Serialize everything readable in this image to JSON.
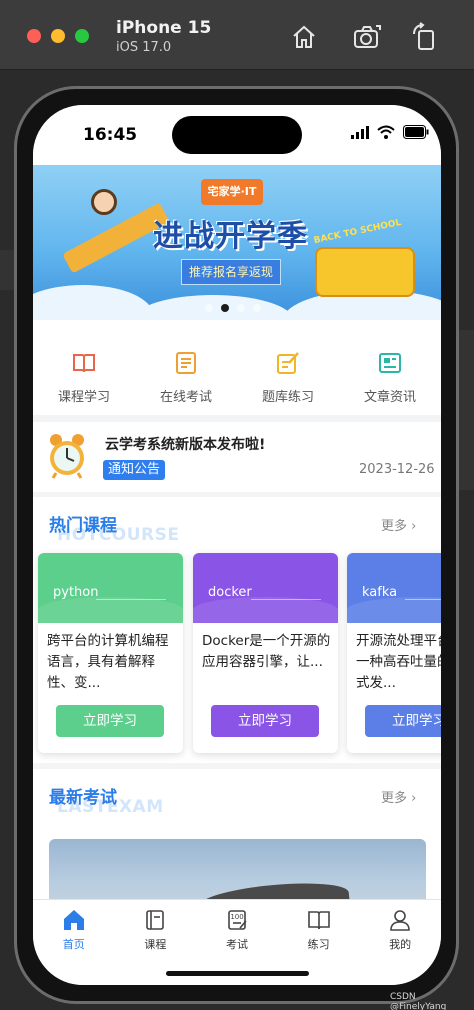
{
  "simulator": {
    "device_name": "iPhone 15",
    "os_version": "iOS 17.0",
    "buttons": [
      "home-icon",
      "screenshot-icon",
      "rotate-icon"
    ]
  },
  "status_bar": {
    "time": "16:45"
  },
  "banner": {
    "logo_text": "宅家学·IT",
    "headline": "进战开学季",
    "promo_button": "推荐报名享返现",
    "tagline": "BACK TO SCHOOL",
    "page_count": 4,
    "active_index": 1
  },
  "categories": [
    {
      "label": "课程学习",
      "icon": "book-icon",
      "color": "#e8674a"
    },
    {
      "label": "在线考试",
      "icon": "exam-form-icon",
      "color": "#f0a030"
    },
    {
      "label": "题库练习",
      "icon": "edit-note-icon",
      "color": "#f0b628"
    },
    {
      "label": "文章资讯",
      "icon": "article-icon",
      "color": "#2bb6a8"
    }
  ],
  "notice": {
    "title": "云学考系统新版本发布啦!",
    "tag": "通知公告",
    "date": "2023-12-26"
  },
  "hot_courses": {
    "title": "热门课程",
    "title_en": "HOTCOURSE",
    "more": "更多",
    "items": [
      {
        "name": "python",
        "description": "跨平台的计算机编程语言，具有着解释性、变...",
        "button": "立即学习",
        "color": "#5ccf8c"
      },
      {
        "name": "docker",
        "description": "Docker是一个开源的应用容器引擎，让...",
        "button": "立即学习",
        "color": "#8a55e6"
      },
      {
        "name": "kafka",
        "description": "开源流处理平台，是一种高吞吐量的分布式发...",
        "button": "立即学习",
        "color": "#5b7fe6"
      }
    ]
  },
  "latest_exams": {
    "title": "最新考试",
    "title_en": "LASTEXAM",
    "more": "更多"
  },
  "tabbar": [
    {
      "label": "首页",
      "icon": "home-tab-icon",
      "active": true
    },
    {
      "label": "课程",
      "icon": "course-book-icon",
      "active": false
    },
    {
      "label": "考试",
      "icon": "exam-score-icon",
      "active": false
    },
    {
      "label": "练习",
      "icon": "open-book-icon",
      "active": false
    },
    {
      "label": "我的",
      "icon": "user-icon",
      "active": false
    }
  ],
  "watermark": "CSDN @FinelyYang",
  "colors": {
    "accent": "#2b7de8",
    "notice_tag": "#2f7ef0"
  }
}
